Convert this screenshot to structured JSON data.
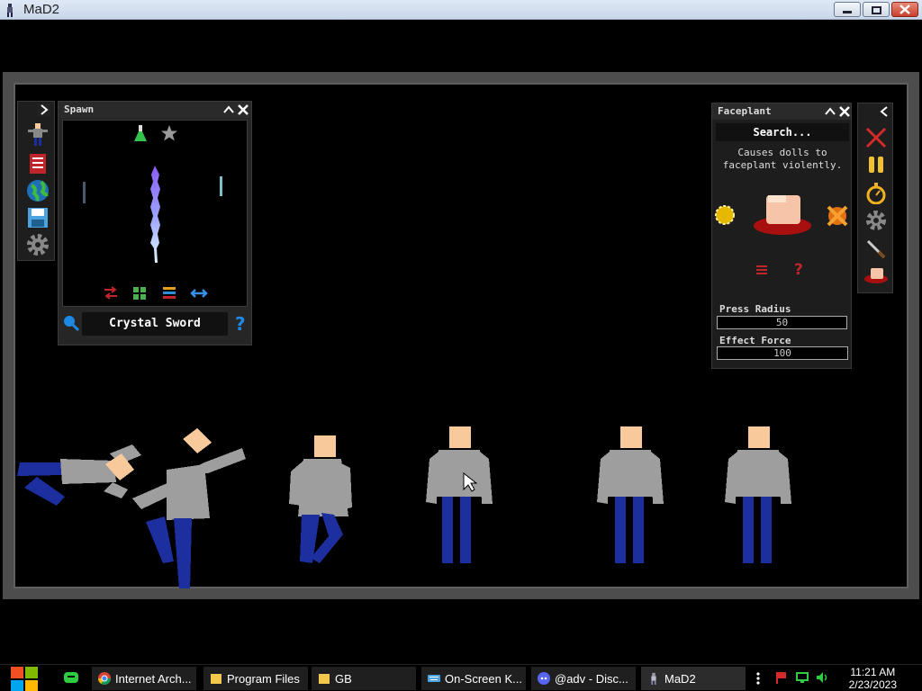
{
  "window": {
    "title": "MaD2"
  },
  "spawn_panel": {
    "title": "Spawn",
    "item_name": "Crystal Sword",
    "icons": [
      "flask-icon",
      "star-icon",
      "swap-icon",
      "grid-icon",
      "list-icon",
      "arrows-icon"
    ]
  },
  "left_toolbar": {
    "icons": [
      "doll-icon",
      "book-icon",
      "globe-icon",
      "save-icon",
      "gear-icon"
    ]
  },
  "faceplant_panel": {
    "title": "Faceplant",
    "search_placeholder": "Search...",
    "description": "Causes dolls to faceplant violently.",
    "press_radius_label": "Press Radius",
    "press_radius_value": "50",
    "effect_force_label": "Effect Force",
    "effect_force_value": "100"
  },
  "right_toolbar": {
    "icons": [
      "close-x-icon",
      "pause-icon",
      "stopwatch-icon",
      "gear-icon",
      "knife-icon",
      "faceplant-icon"
    ]
  },
  "taskbar": {
    "items": [
      {
        "label": "Internet Arch..."
      },
      {
        "label": "Program Files"
      },
      {
        "label": "GB"
      },
      {
        "label": "On-Screen K..."
      },
      {
        "label": "@adv - Disc..."
      },
      {
        "label": "MaD2"
      }
    ],
    "time": "11:21 AM",
    "date": "2/23/2023"
  },
  "colors": {
    "accent_blue": "#1d2f9f",
    "skin": "#f8c99a",
    "shirt": "#9e9e9e"
  }
}
